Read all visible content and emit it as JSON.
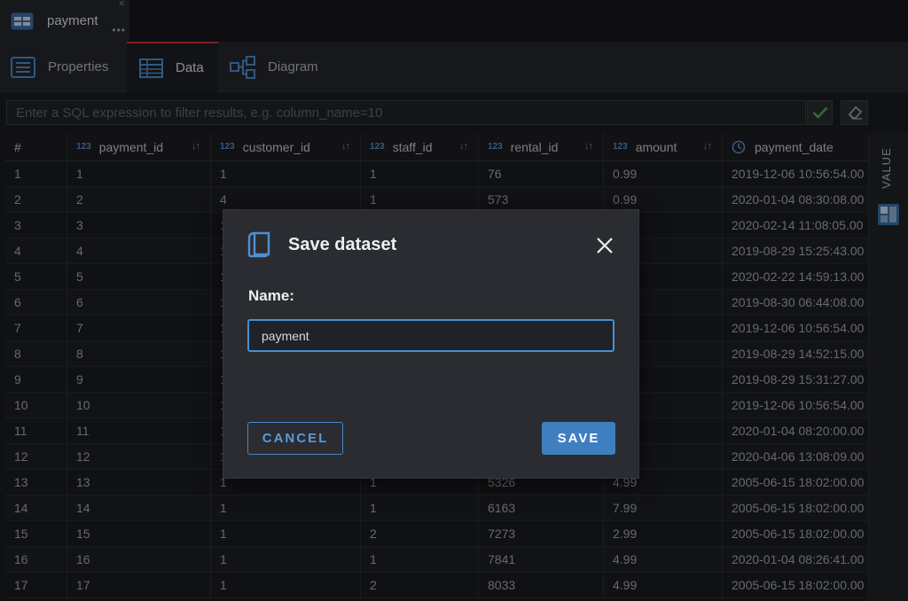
{
  "editor_tab": {
    "title": "payment",
    "close_glyph": "×",
    "more_glyph": "•••"
  },
  "sub_tabs": [
    {
      "label": "Properties",
      "icon": "properties-icon"
    },
    {
      "label": "Data",
      "icon": "table-icon",
      "active": true
    },
    {
      "label": "Diagram",
      "icon": "diagram-icon"
    }
  ],
  "filter": {
    "placeholder": "Enter a SQL expression to filter results, e.g. column_name=10",
    "value": ""
  },
  "grid": {
    "columns": [
      {
        "label": "#",
        "type": ""
      },
      {
        "label": "payment_id",
        "type": "123"
      },
      {
        "label": "customer_id",
        "type": "123"
      },
      {
        "label": "staff_id",
        "type": "123"
      },
      {
        "label": "rental_id",
        "type": "123"
      },
      {
        "label": "amount",
        "type": "123"
      },
      {
        "label": "payment_date",
        "type": "clock"
      }
    ],
    "sort_glyph": "↓↑",
    "rows": [
      [
        "1",
        "1",
        "1",
        "1",
        "76",
        "0.99",
        "2019-12-06 10:56:54.00"
      ],
      [
        "2",
        "2",
        "4",
        "1",
        "573",
        "0.99",
        "2020-01-04 08:30:08.00"
      ],
      [
        "3",
        "3",
        "1",
        "",
        "",
        "",
        "2020-02-14 11:08:05.00"
      ],
      [
        "4",
        "4",
        "1",
        "",
        "",
        "",
        "2019-08-29 15:25:43.00"
      ],
      [
        "5",
        "5",
        "1",
        "",
        "",
        "",
        "2020-02-22 14:59:13.00"
      ],
      [
        "6",
        "6",
        "1",
        "",
        "",
        "",
        "2019-08-30 06:44:08.00"
      ],
      [
        "7",
        "7",
        "1",
        "",
        "",
        "",
        "2019-12-06 10:56:54.00"
      ],
      [
        "8",
        "8",
        "1",
        "",
        "",
        "",
        "2019-08-29 14:52:15.00"
      ],
      [
        "9",
        "9",
        "1",
        "",
        "",
        "",
        "2019-08-29 15:31:27.00"
      ],
      [
        "10",
        "10",
        "1",
        "",
        "",
        "",
        "2019-12-06 10:56:54.00"
      ],
      [
        "11",
        "11",
        "1",
        "",
        "",
        "",
        "2020-01-04 08:20:00.00"
      ],
      [
        "12",
        "12",
        "1",
        "",
        "",
        "",
        "2020-04-06 13:08:09.00"
      ],
      [
        "13",
        "13",
        "1",
        "1",
        "5326",
        "4.99",
        "2005-06-15 18:02:00.00"
      ],
      [
        "14",
        "14",
        "1",
        "1",
        "6163",
        "7.99",
        "2005-06-15 18:02:00.00"
      ],
      [
        "15",
        "15",
        "1",
        "2",
        "7273",
        "2.99",
        "2005-06-15 18:02:00.00"
      ],
      [
        "16",
        "16",
        "1",
        "1",
        "7841",
        "4.99",
        "2020-01-04 08:26:41.00"
      ],
      [
        "17",
        "17",
        "1",
        "2",
        "8033",
        "4.99",
        "2005-06-15 18:02:00.00"
      ]
    ]
  },
  "side_panel": {
    "label": "VALUE"
  },
  "dialog": {
    "title": "Save dataset",
    "name_label": "Name:",
    "name_value": "payment",
    "cancel_label": "CANCEL",
    "save_label": "SAVE"
  },
  "colors": {
    "accent": "#3f7fc0",
    "tab_active_border": "#c8353b",
    "apply_check": "#4caf50"
  }
}
